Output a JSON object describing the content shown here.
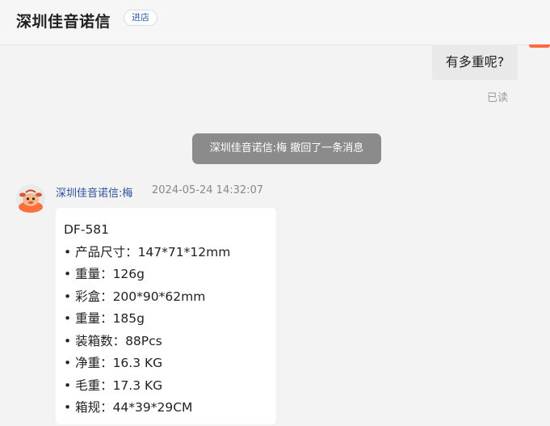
{
  "header": {
    "shop_name": "深圳佳音诺信",
    "enter_shop_label": "进店"
  },
  "outgoing": {
    "message": "有多重呢?",
    "status": "已读"
  },
  "system": {
    "recall_notice": "深圳佳音诺信:梅 撤回了一条消息"
  },
  "incoming": {
    "sender": "深圳佳音诺信:梅",
    "timestamp": "2024-05-24 14:32:07",
    "lines": [
      "DF-581",
      "• 产品尺寸：147*71*12mm",
      "• 重量：126g",
      "• 彩盒：200*90*62mm",
      "• 重量：185g",
      "• 装箱数：88Pcs",
      "• 净重：16.3 KG",
      "• 毛重：17.3 KG",
      "• 箱规：44*39*29CM"
    ]
  },
  "colors": {
    "accent": "#ff6a3d",
    "link": "#2d4f9c",
    "notice_bg": "#8b8b8b"
  },
  "icons": {
    "avatar": "mascot-avatar-icon"
  }
}
